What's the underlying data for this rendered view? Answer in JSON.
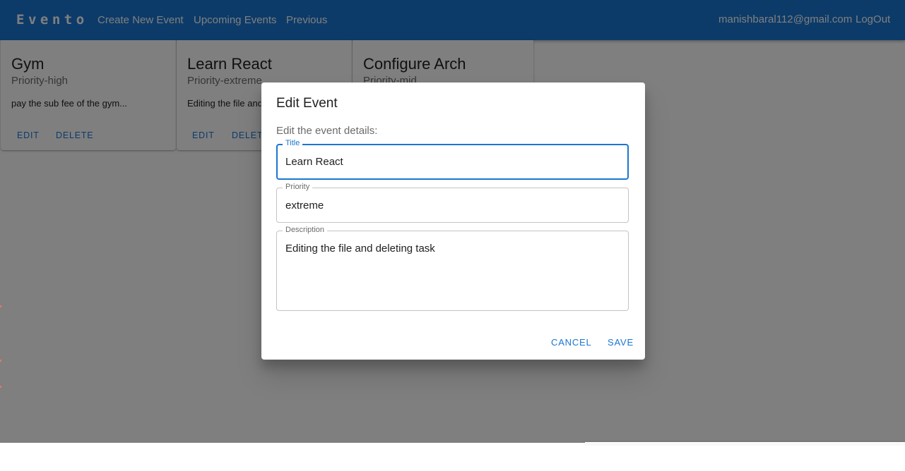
{
  "appbar": {
    "brand": "Evento",
    "nav": [
      {
        "label": "Create New Event"
      },
      {
        "label": "Upcoming Events"
      },
      {
        "label": "Previous"
      }
    ],
    "user_email": "manishbaral112@gmail.com",
    "logout_label": "LogOut"
  },
  "cards": [
    {
      "title": "Gym",
      "priority": "Priority-high",
      "description": "pay the sub fee of the gym...",
      "edit_label": "EDIT",
      "delete_label": "DELETE"
    },
    {
      "title": "Learn React",
      "priority": "Priority-extreme",
      "description": "Editing the file and deleting task",
      "edit_label": "EDIT",
      "delete_label": "DELETE"
    },
    {
      "title": "Configure Arch",
      "priority": "Priority-mid",
      "description": "",
      "edit_label": "",
      "delete_label": ""
    }
  ],
  "dialog": {
    "title": "Edit Event",
    "subtitle": "Edit the event details:",
    "fields": {
      "title": {
        "label": "Title",
        "value": "Learn React"
      },
      "priority": {
        "label": "Priority",
        "value": "extreme"
      },
      "description": {
        "label": "Description",
        "value": "Editing the file and deleting task"
      }
    },
    "cancel_label": "CANCEL",
    "save_label": "SAVE"
  },
  "colors": {
    "primary": "#1976d2",
    "backdrop": "rgba(0,0,0,0.5)"
  }
}
